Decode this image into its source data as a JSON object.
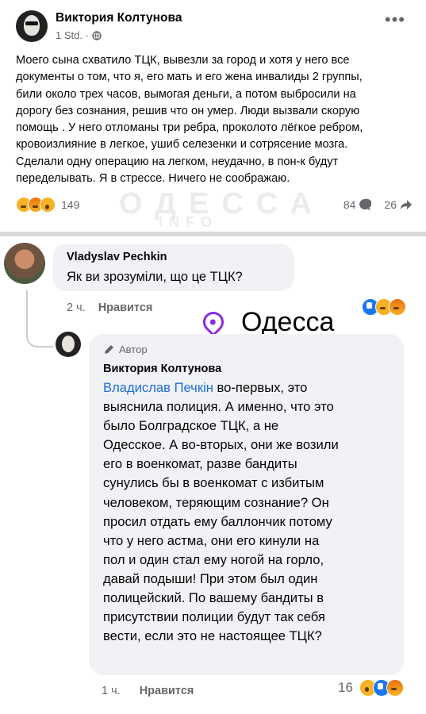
{
  "post": {
    "author": "Виктория Колтунова",
    "time": "1 Std. ·",
    "menu_icon": "more-dots-icon",
    "text": "Моего  сына схватило ТЦК,  вывезли за город и хотя у него все\nдокументы  о том, что я, его мать  и его жена инвалиды 2 группы,\nбили около трех часов, вымогая деньги, а потом выбросили на\nдорогу без сознания, решив что он умер. Люди вызвали скорую\nпомощь . У него отломаны три ребра, проколото лёгкое ребром,\nкровоизлияние в легкое, ушиб селезенки и сотрясение мозга.\nСделали одну операцию на легком, неудачно, в пон-к будут\nпеределывать. Я в стрессе. Ничего не соображаю.",
    "reaction_count": "149",
    "comment_count": "84",
    "share_count": "26",
    "watermark_line1": "ОДЕССА",
    "watermark_line2": "INFO"
  },
  "comment1": {
    "author": "Vladyslav Pechkin",
    "text": "Як ви зрозуміли, що це ТЦК?",
    "time": "2 ч.",
    "like_label": "Нравится"
  },
  "location_overlay": {
    "label": "Одесса",
    "icon": "location-pin-icon",
    "color": "#8a2be2"
  },
  "comment2": {
    "badge": "Автор",
    "author": "Виктория Колтунова",
    "mention": "Владислав Печкін",
    "text": " во-первых, это\nвыяснила полиция. А именно, что это\nбыло Болградское ТЦК, а не\nОдесское. А во-вторых, они же возили\nего в военкомат, разве бандиты\nсунулись бы в военкомат с избитым\nчеловеком, теряющим сознание? Он\nпросил отдать ему баллончик потому\nчто у него астма, они его кинули на\nпол и один стал ему ногой на горло,\nдавай подыши! При этом был один\nполицейский. По вашему бандиты в\nприсутствии полиции будут так себя\nвести, если это не настоящее ТЦК?",
    "time": "1 ч.",
    "like_label": "Нравится",
    "reaction_count": "16"
  }
}
